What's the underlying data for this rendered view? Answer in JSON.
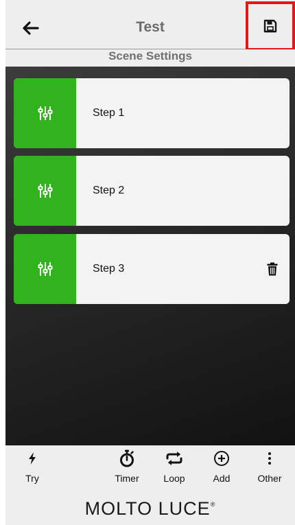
{
  "header": {
    "title": "Test",
    "back_icon": "arrow-left-icon",
    "save_icon": "floppy-disk-icon"
  },
  "subheader": {
    "title": "Scene Settings"
  },
  "steps": [
    {
      "label": "Step 1",
      "icon": "sliders-icon"
    },
    {
      "label": "Step 2",
      "icon": "sliders-icon"
    },
    {
      "label": "Step 3",
      "icon": "sliders-icon",
      "trash_icon": "trash-icon"
    }
  ],
  "toolbar": {
    "items": [
      {
        "label": "Try",
        "icon": "bolt-icon"
      },
      {
        "label": "Timer",
        "icon": "stopwatch-icon"
      },
      {
        "label": "Loop",
        "icon": "loop-icon"
      },
      {
        "label": "Add",
        "icon": "plus-circle-icon"
      },
      {
        "label": "Other",
        "icon": "more-vertical-icon"
      }
    ]
  },
  "footer": {
    "brand": "MOLTO LUCE",
    "brand_mark": "®"
  },
  "colors": {
    "accent_green": "#31b31e",
    "highlight_red": "#e51616",
    "bar_gray": "#eeeeee"
  }
}
